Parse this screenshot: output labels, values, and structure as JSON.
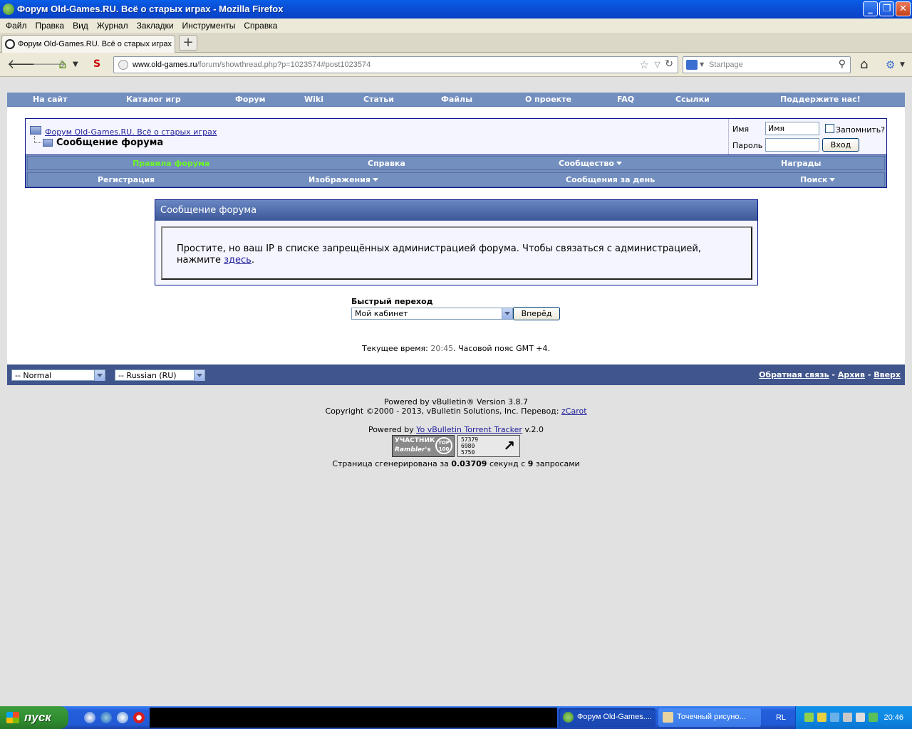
{
  "window": {
    "title": "Форум Old-Games.RU. Всё о старых играх - Mozilla Firefox",
    "minimize": "_",
    "maximize": "❐",
    "close": "✕"
  },
  "menu": [
    "Файл",
    "Правка",
    "Вид",
    "Журнал",
    "Закладки",
    "Инструменты",
    "Справка"
  ],
  "tab": {
    "title": "Форум Old-Games.RU. Всё о старых играх",
    "new_tab": "+"
  },
  "urlbar": {
    "domain": "www.old-games.ru",
    "path": "/forum/showthread.php?p=1023574#post1023574"
  },
  "searchbar": {
    "placeholder": "Startpage"
  },
  "site_nav": [
    "На сайт",
    "Каталог игр",
    "Форум",
    "Wiki",
    "Статьи",
    "Файлы",
    "О проекте",
    "FAQ",
    "Ссылки",
    "Поддержите нас!"
  ],
  "breadcrumb": {
    "forum": "Форум Old-Games.RU. Всё о старых играх",
    "current": "Сообщение форума"
  },
  "login": {
    "username_label": "Имя",
    "username_value": "Имя",
    "remember_label": "Запомнить?",
    "password_label": "Пароль",
    "submit": "Вход"
  },
  "forum_nav": {
    "row1": [
      "Правила форума",
      "Справка",
      "Сообщество",
      "Награды"
    ],
    "row2": [
      "Регистрация",
      "Изображения",
      "Сообщения за день",
      "Поиск"
    ]
  },
  "message": {
    "title": "Сообщение форума",
    "text": "Простите, но ваш IP в списке запрещённых администрацией форума. Чтобы связаться с администрацией, нажмите ",
    "link": "здесь",
    "end": "."
  },
  "quick_nav": {
    "label": "Быстрый переход",
    "selected": "Мой кабинет",
    "button": "Вперёд"
  },
  "current_time": {
    "prefix": "Текущее время: ",
    "time": "20:45",
    "suffix": ". Часовой пояс GMT +4."
  },
  "footer": {
    "style_select": "-- Normal",
    "lang_select": "-- Russian (RU)",
    "links": [
      "Обратная связь",
      "Архив",
      "Вверх"
    ],
    "separator": " - "
  },
  "powered": {
    "line1": "Powered by vBulletin® Version 3.8.7",
    "line2_prefix": "Copyright ©2000 - 2013, vBulletin Solutions, Inc. Перевод: ",
    "line2_link": "zCarot",
    "line3_prefix": "Powered by ",
    "line3_link": "Yo vBulletin Torrent Tracker",
    "line3_suffix": " v.2.0",
    "gen_prefix": "Страница сгенерирована за ",
    "gen_time": "0.03709",
    "gen_mid": " секунд с ",
    "gen_queries": "9",
    "gen_suffix": " запросами"
  },
  "banners": {
    "rambler_top": "УЧАСТНИК",
    "rambler_bottom": "Rambler's",
    "rambler_badge": "TOP 100",
    "counter": [
      "57379",
      "6980",
      "5750"
    ],
    "counter_arrow": "↗"
  },
  "taskbar": {
    "start": "пуск",
    "buttons": [
      "Форум Old-Games....",
      "Точечный рисуно..."
    ],
    "lang": "RL",
    "clock": "20:46"
  }
}
